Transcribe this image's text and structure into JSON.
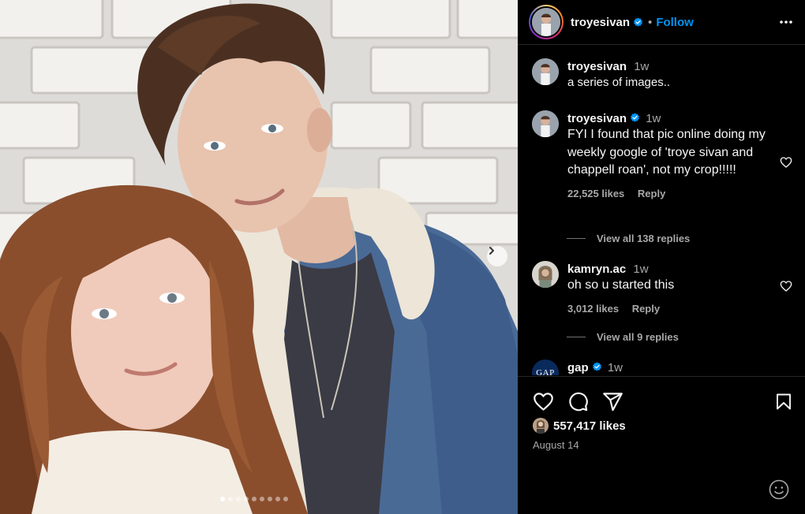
{
  "post": {
    "author": "troyesivan",
    "verified": true,
    "follow_separator": "•",
    "follow_label": "Follow",
    "carousel_dots": 9,
    "carousel_active": 0
  },
  "comments": [
    {
      "username": "troyesivan",
      "verified": false,
      "time": "1w",
      "text": "a series of images..",
      "likes": "",
      "reply": ""
    },
    {
      "username": "troyesivan",
      "verified": true,
      "time": "1w",
      "text": "FYI I found that pic online doing my weekly google of 'troye sivan and chappell roan', not my crop!!!!!",
      "likes": "22,525 likes",
      "reply": "Reply",
      "view_replies": "View all 138 replies"
    },
    {
      "username": "kamryn.ac",
      "verified": false,
      "time": "1w",
      "text": "oh so u started this",
      "likes": "3,012 likes",
      "reply": "Reply",
      "view_replies": "View all 9 replies"
    },
    {
      "username": "gap",
      "verified": true,
      "time": "1w",
      "avatar_text": "GAP"
    }
  ],
  "footer": {
    "likes": "557,417 likes",
    "date": "August 14"
  },
  "colors": {
    "background": "#000000",
    "text": "#f5f5f5",
    "muted": "#a8a8a8",
    "link": "#0095f6",
    "verified": "#0095f6",
    "divider": "#262626"
  },
  "icons": {
    "header_more": "more-horizontal-icon",
    "like": "heart-icon",
    "comment": "comment-icon",
    "share": "send-icon",
    "save": "bookmark-icon",
    "emoji": "emoji-icon",
    "carousel_next": "chevron-right-icon"
  }
}
